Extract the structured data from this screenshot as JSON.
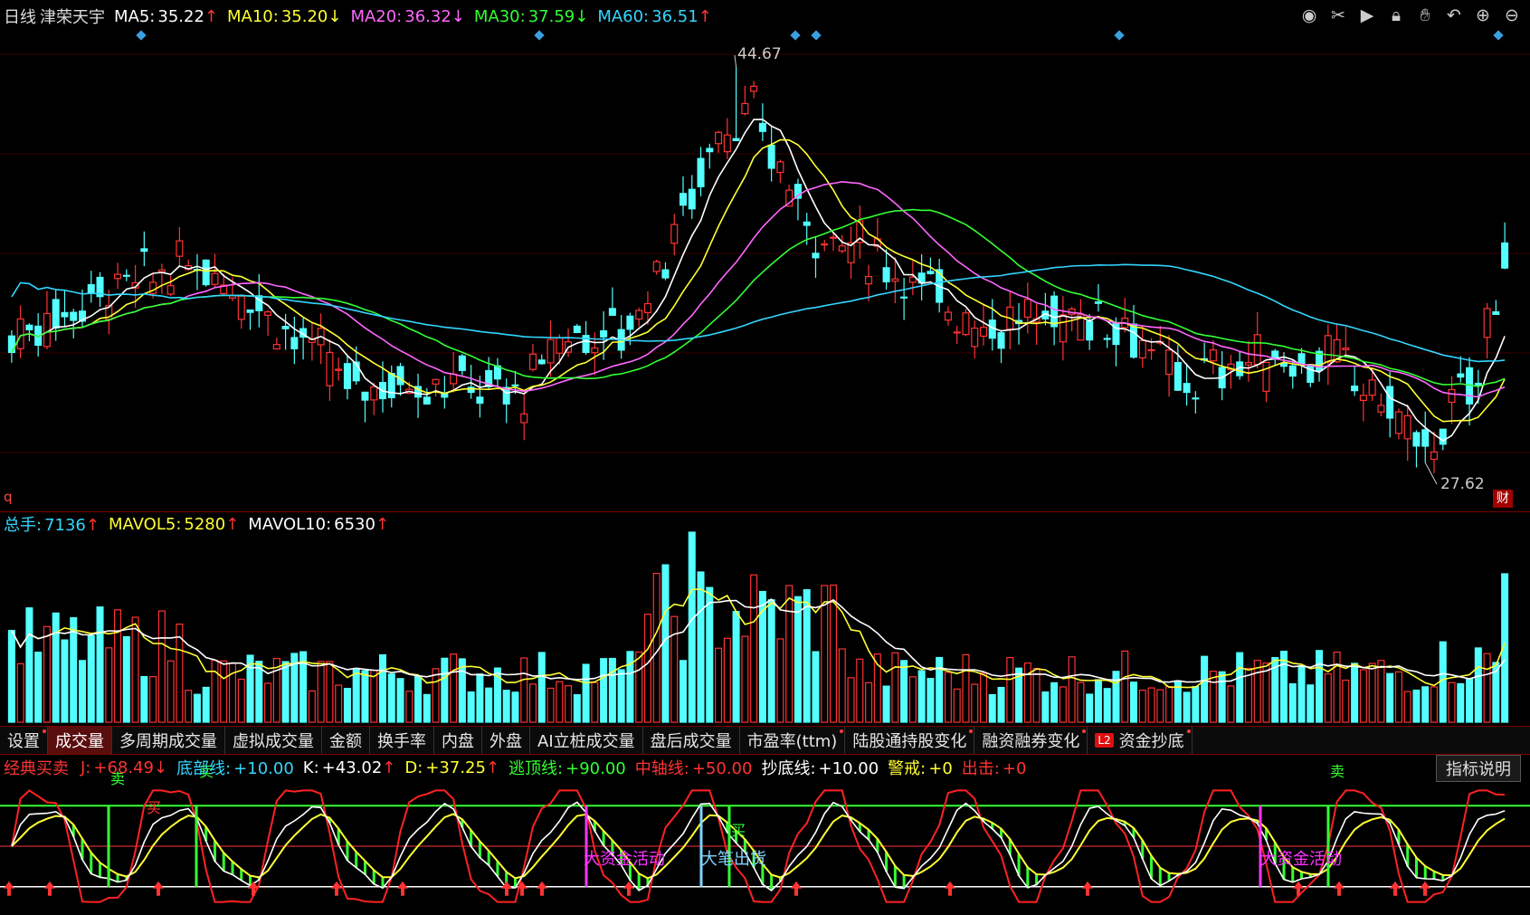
{
  "main_header": {
    "period": "日线",
    "stock_name": "津荣天宇",
    "ma": [
      {
        "label": "MA5:",
        "value": "35.22",
        "arrow": "↑",
        "color": "#ffffff"
      },
      {
        "label": "MA10:",
        "value": "35.20",
        "arrow": "↓",
        "color": "#ffff33"
      },
      {
        "label": "MA20:",
        "value": "36.32",
        "arrow": "↓",
        "color": "#ff66ff"
      },
      {
        "label": "MA30:",
        "value": "37.59",
        "arrow": "↓",
        "color": "#33ff33"
      },
      {
        "label": "MA60:",
        "value": "36.51",
        "arrow": "↑",
        "color": "#33d6ff"
      }
    ]
  },
  "price_labels": {
    "high": "44.67",
    "low": "27.62",
    "q_marker": "q",
    "cai_badge": "财"
  },
  "toolbar_icons": [
    "eye-icon",
    "scissors-icon",
    "play-icon",
    "lock-icon",
    "hand-icon",
    "undo-icon",
    "zoom-in-icon",
    "zoom-out-icon"
  ],
  "volume_header": [
    {
      "label": "总手:",
      "value": "7136",
      "arrow": "↑",
      "color": "#33d6ff"
    },
    {
      "label": "MAVOL5:",
      "value": "5280",
      "arrow": "↑",
      "color": "#ffff33"
    },
    {
      "label": "MAVOL10:",
      "value": "6530",
      "arrow": "↑",
      "color": "#ffffff"
    }
  ],
  "tabs": [
    {
      "label": "设置",
      "active": false,
      "dot": true
    },
    {
      "label": "成交量",
      "active": true,
      "dot": false
    },
    {
      "label": "多周期成交量",
      "active": false,
      "dot": false
    },
    {
      "label": "虚拟成交量",
      "active": false,
      "dot": false
    },
    {
      "label": "金额",
      "active": false,
      "dot": false
    },
    {
      "label": "换手率",
      "active": false,
      "dot": false
    },
    {
      "label": "内盘",
      "active": false,
      "dot": false
    },
    {
      "label": "外盘",
      "active": false,
      "dot": false
    },
    {
      "label": "AI立桩成交量",
      "active": false,
      "dot": false
    },
    {
      "label": "盘后成交量",
      "active": false,
      "dot": false
    },
    {
      "label": "市盈率(ttm)",
      "active": false,
      "dot": true
    },
    {
      "label": "陆股通持股变化",
      "active": false,
      "dot": true
    },
    {
      "label": "融资融券变化",
      "active": false,
      "dot": true
    },
    {
      "label": "资金抄底",
      "active": false,
      "dot": true,
      "badge": "L2"
    }
  ],
  "indicator_header": [
    {
      "label": "经典买卖",
      "value": "",
      "arrow": "",
      "color": "#ff3333"
    },
    {
      "label": "J:",
      "value": "+68.49",
      "arrow": "↓",
      "color": "#ff3333"
    },
    {
      "label": "底部线:",
      "value": "+10.00",
      "arrow": "",
      "color": "#33d6ff"
    },
    {
      "label": "K:",
      "value": "+43.02",
      "arrow": "↑",
      "color": "#ffffff"
    },
    {
      "label": "D:",
      "value": "+37.25",
      "arrow": "↑",
      "color": "#ffff33"
    },
    {
      "label": "逃顶线:",
      "value": "+90.00",
      "arrow": "",
      "color": "#33ff33"
    },
    {
      "label": "中轴线:",
      "value": "+50.00",
      "arrow": "",
      "color": "#ff3333"
    },
    {
      "label": "抄底线:",
      "value": "+10.00",
      "arrow": "",
      "color": "#ffffff"
    },
    {
      "label": "警戒:",
      "value": "+0",
      "arrow": "",
      "color": "#ffff33"
    },
    {
      "label": "出击:",
      "value": "+0",
      "arrow": "",
      "color": "#ff3333"
    }
  ],
  "indicator_explain_button": "指标说明",
  "indicator_annotations": [
    {
      "text": "大资金活动",
      "color": "#ff33ff"
    },
    {
      "text": "大笔出货",
      "color": "#7fd4ff"
    },
    {
      "text": "大资金活动",
      "color": "#ff33ff"
    }
  ],
  "signal_labels": {
    "sell": "卖",
    "buy": "买"
  },
  "colors": {
    "up": "#ff3333",
    "down": "#54ffff",
    "ma5": "#ffffff",
    "ma10": "#ffff33",
    "ma20": "#ff66ff",
    "ma30": "#33ff33",
    "ma60": "#33d6ff"
  }
}
